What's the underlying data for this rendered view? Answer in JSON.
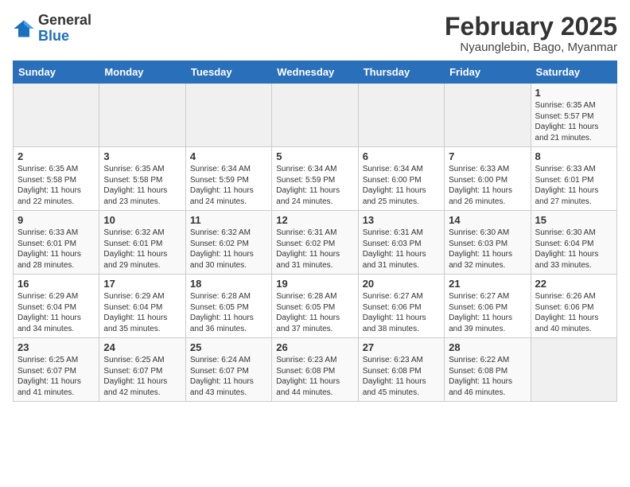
{
  "header": {
    "logo_general": "General",
    "logo_blue": "Blue",
    "month_title": "February 2025",
    "location": "Nyaunglebin, Bago, Myanmar"
  },
  "weekdays": [
    "Sunday",
    "Monday",
    "Tuesday",
    "Wednesday",
    "Thursday",
    "Friday",
    "Saturday"
  ],
  "weeks": [
    [
      {
        "day": "",
        "info": ""
      },
      {
        "day": "",
        "info": ""
      },
      {
        "day": "",
        "info": ""
      },
      {
        "day": "",
        "info": ""
      },
      {
        "day": "",
        "info": ""
      },
      {
        "day": "",
        "info": ""
      },
      {
        "day": "1",
        "info": "Sunrise: 6:35 AM\nSunset: 5:57 PM\nDaylight: 11 hours and 21 minutes."
      }
    ],
    [
      {
        "day": "2",
        "info": "Sunrise: 6:35 AM\nSunset: 5:58 PM\nDaylight: 11 hours and 22 minutes."
      },
      {
        "day": "3",
        "info": "Sunrise: 6:35 AM\nSunset: 5:58 PM\nDaylight: 11 hours and 23 minutes."
      },
      {
        "day": "4",
        "info": "Sunrise: 6:34 AM\nSunset: 5:59 PM\nDaylight: 11 hours and 24 minutes."
      },
      {
        "day": "5",
        "info": "Sunrise: 6:34 AM\nSunset: 5:59 PM\nDaylight: 11 hours and 24 minutes."
      },
      {
        "day": "6",
        "info": "Sunrise: 6:34 AM\nSunset: 6:00 PM\nDaylight: 11 hours and 25 minutes."
      },
      {
        "day": "7",
        "info": "Sunrise: 6:33 AM\nSunset: 6:00 PM\nDaylight: 11 hours and 26 minutes."
      },
      {
        "day": "8",
        "info": "Sunrise: 6:33 AM\nSunset: 6:01 PM\nDaylight: 11 hours and 27 minutes."
      }
    ],
    [
      {
        "day": "9",
        "info": "Sunrise: 6:33 AM\nSunset: 6:01 PM\nDaylight: 11 hours and 28 minutes."
      },
      {
        "day": "10",
        "info": "Sunrise: 6:32 AM\nSunset: 6:01 PM\nDaylight: 11 hours and 29 minutes."
      },
      {
        "day": "11",
        "info": "Sunrise: 6:32 AM\nSunset: 6:02 PM\nDaylight: 11 hours and 30 minutes."
      },
      {
        "day": "12",
        "info": "Sunrise: 6:31 AM\nSunset: 6:02 PM\nDaylight: 11 hours and 31 minutes."
      },
      {
        "day": "13",
        "info": "Sunrise: 6:31 AM\nSunset: 6:03 PM\nDaylight: 11 hours and 31 minutes."
      },
      {
        "day": "14",
        "info": "Sunrise: 6:30 AM\nSunset: 6:03 PM\nDaylight: 11 hours and 32 minutes."
      },
      {
        "day": "15",
        "info": "Sunrise: 6:30 AM\nSunset: 6:04 PM\nDaylight: 11 hours and 33 minutes."
      }
    ],
    [
      {
        "day": "16",
        "info": "Sunrise: 6:29 AM\nSunset: 6:04 PM\nDaylight: 11 hours and 34 minutes."
      },
      {
        "day": "17",
        "info": "Sunrise: 6:29 AM\nSunset: 6:04 PM\nDaylight: 11 hours and 35 minutes."
      },
      {
        "day": "18",
        "info": "Sunrise: 6:28 AM\nSunset: 6:05 PM\nDaylight: 11 hours and 36 minutes."
      },
      {
        "day": "19",
        "info": "Sunrise: 6:28 AM\nSunset: 6:05 PM\nDaylight: 11 hours and 37 minutes."
      },
      {
        "day": "20",
        "info": "Sunrise: 6:27 AM\nSunset: 6:06 PM\nDaylight: 11 hours and 38 minutes."
      },
      {
        "day": "21",
        "info": "Sunrise: 6:27 AM\nSunset: 6:06 PM\nDaylight: 11 hours and 39 minutes."
      },
      {
        "day": "22",
        "info": "Sunrise: 6:26 AM\nSunset: 6:06 PM\nDaylight: 11 hours and 40 minutes."
      }
    ],
    [
      {
        "day": "23",
        "info": "Sunrise: 6:25 AM\nSunset: 6:07 PM\nDaylight: 11 hours and 41 minutes."
      },
      {
        "day": "24",
        "info": "Sunrise: 6:25 AM\nSunset: 6:07 PM\nDaylight: 11 hours and 42 minutes."
      },
      {
        "day": "25",
        "info": "Sunrise: 6:24 AM\nSunset: 6:07 PM\nDaylight: 11 hours and 43 minutes."
      },
      {
        "day": "26",
        "info": "Sunrise: 6:23 AM\nSunset: 6:08 PM\nDaylight: 11 hours and 44 minutes."
      },
      {
        "day": "27",
        "info": "Sunrise: 6:23 AM\nSunset: 6:08 PM\nDaylight: 11 hours and 45 minutes."
      },
      {
        "day": "28",
        "info": "Sunrise: 6:22 AM\nSunset: 6:08 PM\nDaylight: 11 hours and 46 minutes."
      },
      {
        "day": "",
        "info": ""
      }
    ]
  ]
}
